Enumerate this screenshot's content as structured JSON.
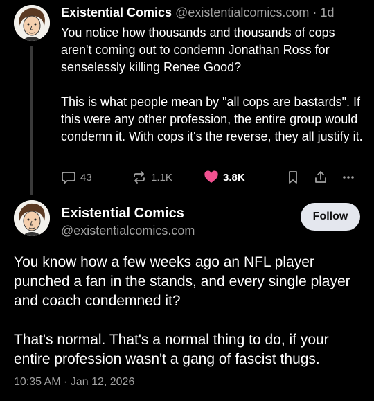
{
  "post1": {
    "author_name": "Existential Comics",
    "handle": "@existentialcomics.com",
    "separator": "·",
    "age": "1d",
    "paragraphs": [
      "You notice how thousands and thousands of cops aren't coming out to condemn Jonathan Ross for senselessly killing Renee Good?",
      "This is what people mean by \"all cops are bastards\". If this were any other profession, the entire group would condemn it. With cops it's the reverse, they all justify it."
    ],
    "actions": {
      "replies": "43",
      "reposts": "1.1K",
      "likes": "3.8K",
      "liked": true,
      "icons": [
        "reply-icon",
        "repost-icon",
        "heart-icon",
        "bookmark-icon",
        "share-icon",
        "more-icon"
      ]
    }
  },
  "post2": {
    "author_name": "Existential Comics",
    "handle": "@existentialcomics.com",
    "follow_label": "Follow",
    "paragraphs": [
      "You know how a few weeks ago an NFL player punched a fan in the stands, and every single player and coach condemned it?",
      "That's normal. That's a normal thing to do, if your entire profession wasn't a gang of fascist thugs."
    ],
    "timestamp": "10:35 AM · Jan 12, 2026"
  },
  "colors": {
    "background": "#000000",
    "text": "#ffffff",
    "muted": "#a1a1a1",
    "like": "#f0508f",
    "follow_button": "#e4e7ee",
    "thread_line": "#3a3a3a"
  }
}
